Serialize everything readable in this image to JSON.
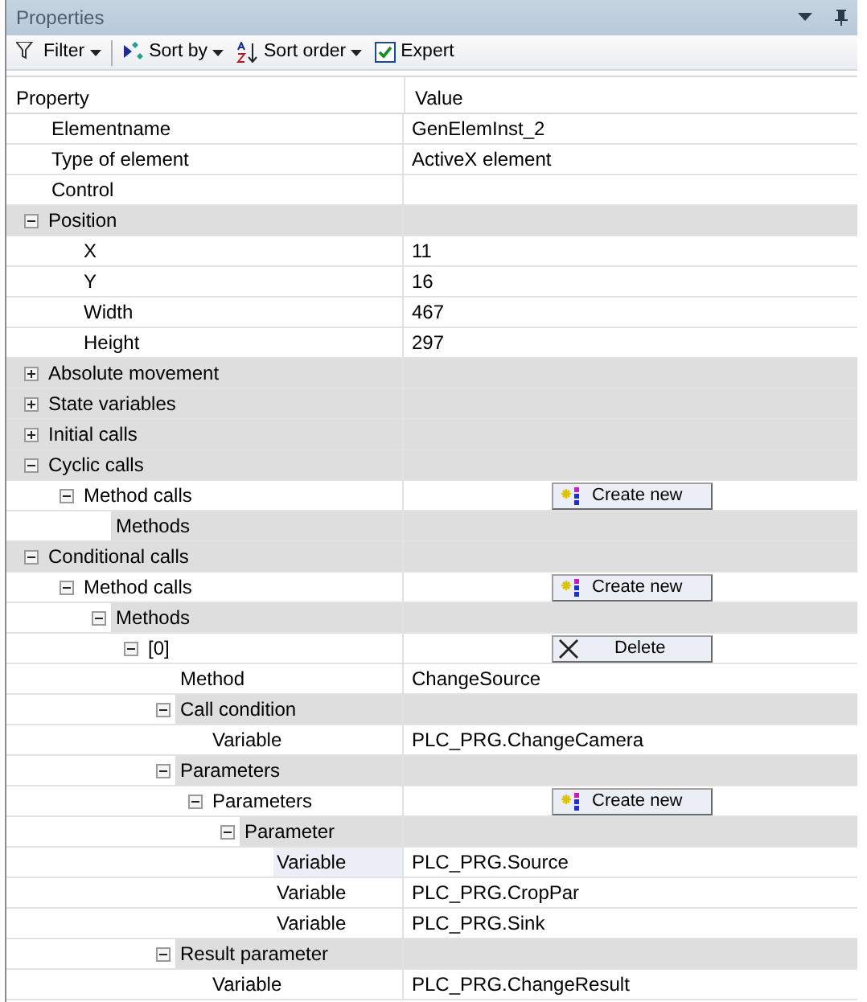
{
  "panel": {
    "title": "Properties"
  },
  "toolbar": [
    {
      "kind": "filter",
      "label": "Filter",
      "dropdown": true
    },
    {
      "kind": "sortby",
      "label": "Sort by",
      "dropdown": true
    },
    {
      "kind": "sortorder",
      "label": "Sort order",
      "dropdown": true
    },
    {
      "kind": "checkbox",
      "label": "Expert",
      "checked": true
    }
  ],
  "table": {
    "columns": [
      "Property",
      "Value"
    ],
    "rows": [
      {
        "kind": "property",
        "label": "Elementname",
        "value": "GenElemInst_2",
        "selected": false
      },
      {
        "kind": "property",
        "label": "Type of element",
        "value": "ActiveX element",
        "selected": false
      },
      {
        "kind": "property",
        "label": "Control",
        "selected": false
      },
      {
        "kind": "group",
        "label": "Position",
        "expanded": true,
        "selected": false,
        "children": [
          {
            "kind": "property",
            "label": "X",
            "value": "11",
            "selected": false
          },
          {
            "kind": "property",
            "label": "Y",
            "value": "16",
            "selected": false
          },
          {
            "kind": "property",
            "label": "Width",
            "value": "467",
            "selected": false
          },
          {
            "kind": "property",
            "label": "Height",
            "value": "297",
            "selected": false
          }
        ]
      },
      {
        "kind": "group",
        "label": "Absolute movement",
        "expanded": false,
        "selected": false
      },
      {
        "kind": "group",
        "label": "State variables",
        "expanded": false,
        "selected": false
      },
      {
        "kind": "group",
        "label": "Initial calls",
        "expanded": false,
        "selected": false
      },
      {
        "kind": "group",
        "label": "Cyclic calls",
        "expanded": true,
        "selected": false,
        "children": [
          {
            "kind": "property",
            "label": "Method calls",
            "expanded": true,
            "selected": false,
            "button": {
              "kind": "create",
              "label": "Create new"
            },
            "children": [
              {
                "kind": "group",
                "label": "Methods",
                "selected": false
              }
            ]
          }
        ]
      },
      {
        "kind": "group",
        "label": "Conditional calls",
        "expanded": true,
        "selected": false,
        "children": [
          {
            "kind": "property",
            "label": "Method calls",
            "expanded": true,
            "selected": false,
            "button": {
              "kind": "create",
              "label": "Create new"
            },
            "children": [
              {
                "kind": "group",
                "label": "Methods",
                "expanded": true,
                "selected": false,
                "children": [
                  {
                    "kind": "property",
                    "label": "[0]",
                    "expanded": true,
                    "selected": false,
                    "button": {
                      "kind": "delete",
                      "label": "Delete"
                    },
                    "children": [
                      {
                        "kind": "property",
                        "label": "Method",
                        "value": "ChangeSource",
                        "selected": false
                      },
                      {
                        "kind": "group",
                        "label": "Call condition",
                        "expanded": true,
                        "selected": false,
                        "children": [
                          {
                            "kind": "property",
                            "label": "Variable",
                            "value": "PLC_PRG.ChangeCamera",
                            "selected": false
                          }
                        ]
                      },
                      {
                        "kind": "group",
                        "label": "Parameters",
                        "expanded": true,
                        "selected": false,
                        "children": [
                          {
                            "kind": "property",
                            "label": "Parameters",
                            "expanded": true,
                            "selected": false,
                            "button": {
                              "kind": "create",
                              "label": "Create new"
                            },
                            "children": [
                              {
                                "kind": "group",
                                "label": "Parameter",
                                "expanded": true,
                                "selected": false,
                                "children": [
                                  {
                                    "kind": "property",
                                    "label": "Variable",
                                    "value": "PLC_PRG.Source",
                                    "selected": true
                                  },
                                  {
                                    "kind": "property",
                                    "label": "Variable",
                                    "value": "PLC_PRG.CropPar",
                                    "selected": false
                                  },
                                  {
                                    "kind": "property",
                                    "label": "Variable",
                                    "value": "PLC_PRG.Sink",
                                    "selected": false
                                  }
                                ]
                              }
                            ]
                          }
                        ]
                      },
                      {
                        "kind": "group",
                        "label": "Result parameter",
                        "expanded": true,
                        "selected": false,
                        "children": [
                          {
                            "kind": "property",
                            "label": "Variable",
                            "value": "PLC_PRG.ChangeResult",
                            "selected": false
                          }
                        ]
                      }
                    ]
                  }
                ]
              }
            ]
          }
        ]
      }
    ]
  }
}
